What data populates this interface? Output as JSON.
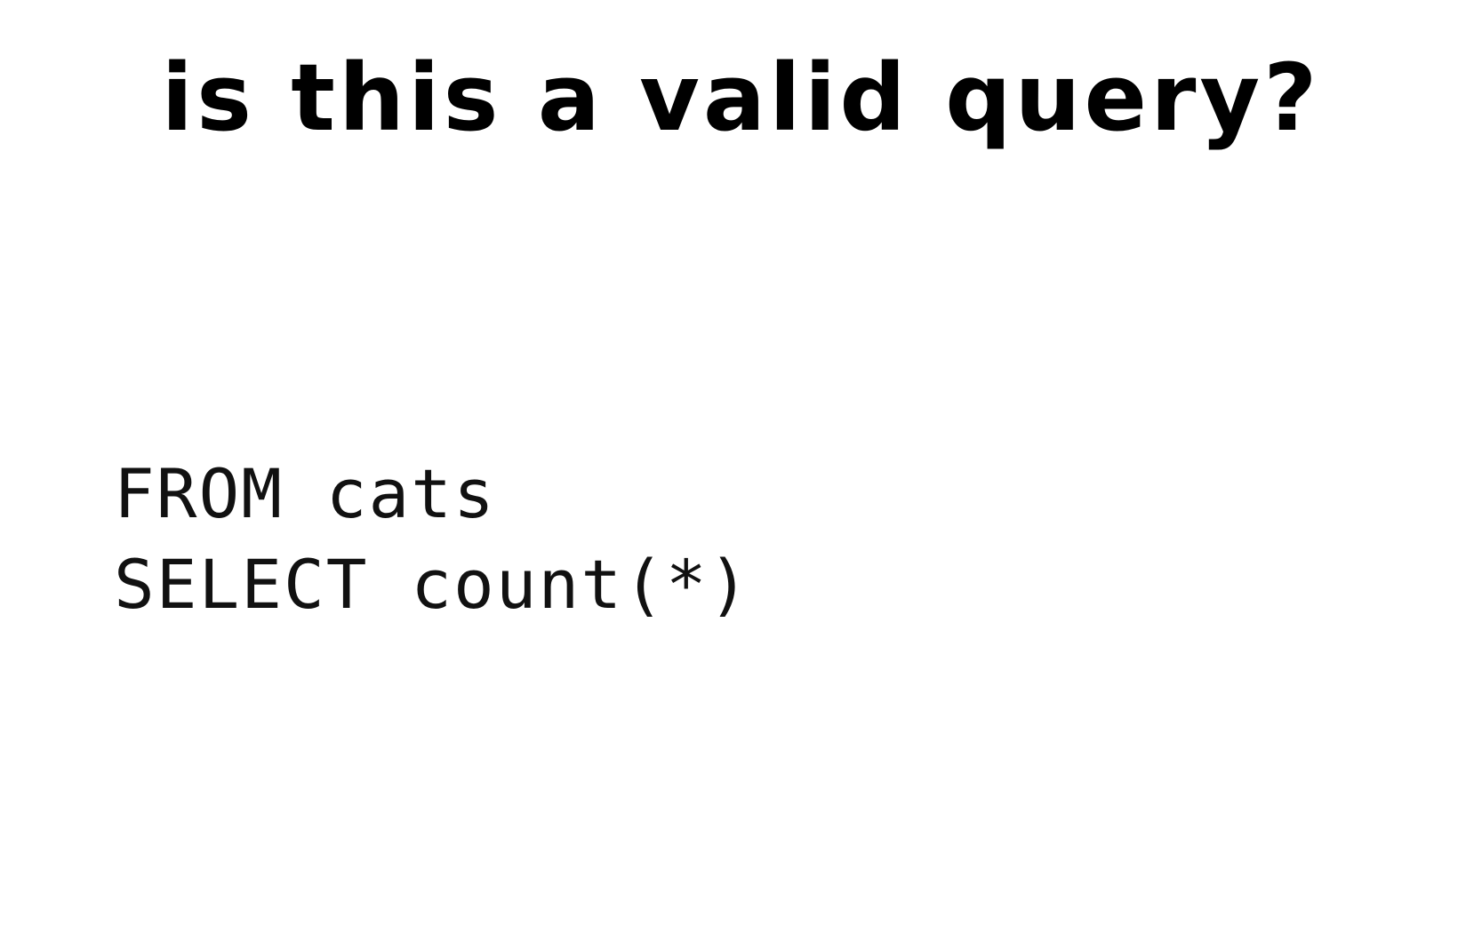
{
  "slide": {
    "title": "is this a valid query?",
    "code_lines": [
      "FROM cats",
      "SELECT count(*)"
    ]
  }
}
